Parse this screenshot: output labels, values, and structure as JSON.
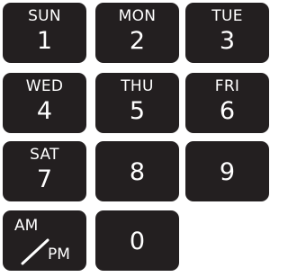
{
  "keys": [
    {
      "day": "SUN",
      "number": "1"
    },
    {
      "day": "MON",
      "number": "2"
    },
    {
      "day": "TUE",
      "number": "3"
    },
    {
      "day": "WED",
      "number": "4"
    },
    {
      "day": "THU",
      "number": "5"
    },
    {
      "day": "FRI",
      "number": "6"
    },
    {
      "day": "SAT",
      "number": "7"
    },
    {
      "number": "8"
    },
    {
      "number": "9"
    },
    {
      "am": "AM",
      "pm": "PM"
    },
    {
      "number": "0"
    }
  ],
  "colors": {
    "key_background": "#231f20",
    "key_text": "#ffffff"
  },
  "icons": {
    "ampm_divider": "slash-icon"
  }
}
